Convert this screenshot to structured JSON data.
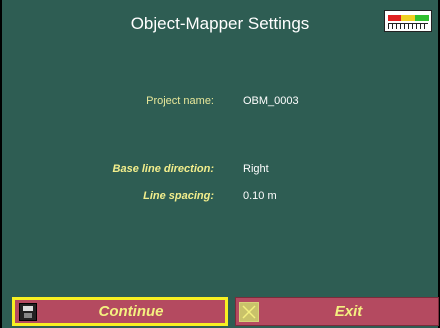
{
  "header": {
    "title": "Object-Mapper Settings",
    "signal_icon": "signal-strength-meter",
    "signal_colors": [
      "#e02020",
      "#f0d020",
      "#30c030"
    ]
  },
  "settings": {
    "project_name_label": "Project name:",
    "project_name_value": "OBM_0003",
    "baseline_label": "Base line direction:",
    "baseline_value": "Right",
    "spacing_label": "Line spacing:",
    "spacing_value": "0.10 m"
  },
  "footer": {
    "continue_label": "Continue",
    "continue_icon": "floppy-disk-icon",
    "exit_label": "Exit",
    "exit_icon": "close-x-icon",
    "accent_color": "#f7f022",
    "button_color": "#b44a60"
  }
}
